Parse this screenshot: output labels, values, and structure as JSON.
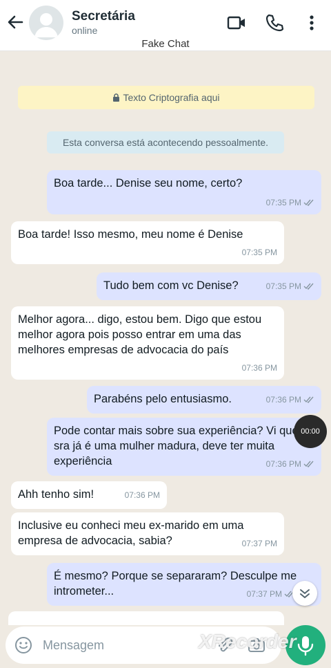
{
  "header": {
    "title": "Secretária",
    "status": "online",
    "app_name": "Fake Chat",
    "icons": [
      "back-arrow-icon",
      "avatar",
      "video-call-icon",
      "phone-icon",
      "more-options-icon"
    ]
  },
  "system": {
    "encryption": "Texto Criptografia aqui",
    "notice": "Esta conversa está acontecendo pessoalmente."
  },
  "messages": [
    {
      "dir": "out",
      "text": "Boa tarde... Denise seu nome, certo?",
      "time": "07:35 PM"
    },
    {
      "dir": "in",
      "text": "Boa tarde! Isso mesmo, meu nome é Denise",
      "time": "07:35 PM"
    },
    {
      "dir": "out",
      "text": "Tudo bem com vc Denise?",
      "time": "07:35 PM"
    },
    {
      "dir": "in",
      "text": "Melhor agora... digo, estou bem. Digo que estou melhor agora pois posso entrar em uma das melhores empresas de advocacia do país",
      "time": "07:36 PM"
    },
    {
      "dir": "out",
      "text": "Parabéns pelo entusiasmo.",
      "time": "07:36 PM"
    },
    {
      "dir": "out",
      "text": "Pode contar mais sobre sua experiência? Vi que a sra já é uma mulher madura, deve ter muita experiência",
      "time": "07:36 PM"
    },
    {
      "dir": "in",
      "text": "Ahh tenho sim!",
      "time": "07:36 PM"
    },
    {
      "dir": "in",
      "text": "Inclusive eu conheci meu ex-marido em uma empresa de advocacia, sabia?",
      "time": "07:37 PM"
    },
    {
      "dir": "out",
      "text": "É mesmo? Porque se separaram? Desculpe me intrometer...",
      "time": "07:37 PM"
    }
  ],
  "recorder": {
    "time": "00:00"
  },
  "input": {
    "placeholder": "Mensagem"
  },
  "watermark": "XRecorder",
  "colors": {
    "outgoing": "#dde3ff",
    "incoming": "#ffffff",
    "send": "#22b07d",
    "background": "#efeae2"
  }
}
